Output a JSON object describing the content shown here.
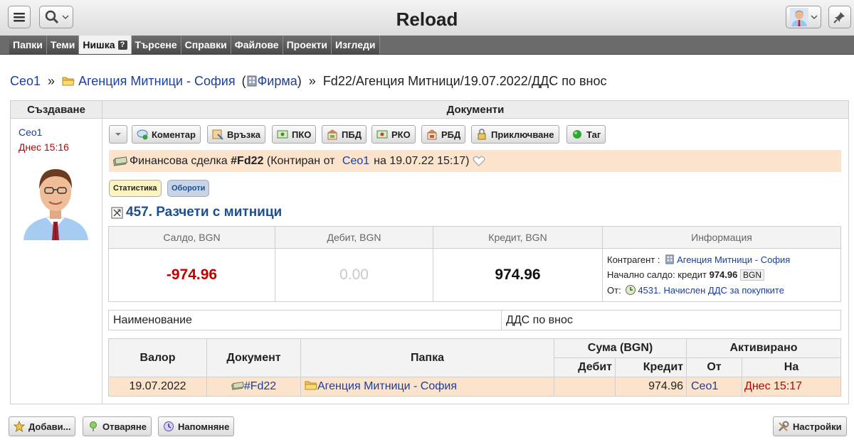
{
  "app": {
    "title": "Reload"
  },
  "nav": {
    "tabs": [
      "Папки",
      "Теми",
      "Нишка",
      "Търсене",
      "Справки",
      "Файлове",
      "Проекти",
      "Изгледи"
    ],
    "help_glyph": "?"
  },
  "breadcrumb": {
    "user": "Ceo1",
    "separator": "»",
    "folder": "Агенция Митници - София",
    "firm_open": "(",
    "firm": "Фирма",
    "firm_close": ")",
    "path": "Fd22/Агенция Митници/19.07.2022/ДДС по внос"
  },
  "left": {
    "header": "Създаване",
    "user": "Ceo1",
    "time": "Днес 15:16"
  },
  "right": {
    "header": "Документи"
  },
  "actions": [
    "Коментар",
    "Връзка",
    "ПКО",
    "ПБД",
    "РКО",
    "РБД",
    "Приключване",
    "Таг"
  ],
  "notice": {
    "prefix": "Финансова сделка",
    "id": "#Fd22",
    "posted": "(Контиран от",
    "user": "Ceo1",
    "on": "на 19.07.22 15:17)"
  },
  "pills": {
    "stats": "Статистика",
    "turnover": "Обороти"
  },
  "account": {
    "title": "457. Разчети с митници"
  },
  "summary": {
    "headers": [
      "Салдо, BGN",
      "Дебит, BGN",
      "Кредит, BGN",
      "Информация"
    ],
    "balance": "-974.96",
    "debit": "0.00",
    "credit": "974.96",
    "info": {
      "counterparty_label": "Контрагент :",
      "counterparty": "Агенция Митници - София",
      "opening_label": "Начално салдо: кредит",
      "opening_value": "974.96",
      "currency": "BGN",
      "from_label": "От:",
      "from_value": "4531. Начислен ДДС за покупките"
    }
  },
  "name_row": {
    "label": "Наименование",
    "value": "ДДС по внос"
  },
  "docs": {
    "headers": {
      "valor": "Валор",
      "document": "Документ",
      "folder": "Папка",
      "amount": "Сума (BGN)",
      "debit": "Дебит",
      "credit": "Кредит",
      "activated": "Активирано",
      "from": "От",
      "on": "На"
    },
    "rows": [
      {
        "valor": "19.07.2022",
        "document": "#Fd22",
        "folder": "Агенция Митници - София",
        "debit": "",
        "credit": "974.96",
        "from": "Ceo1",
        "on": "Днес 15:17"
      }
    ]
  },
  "bottom": {
    "add": "Добави...",
    "open": "Отваряне",
    "remind": "Напомняне",
    "settings": "Настройки"
  },
  "colors": {
    "link": "#1a3f9c",
    "negative": "#c00000",
    "highlight_row": "#fbe3cc",
    "nav_bg": "#6b6b6b"
  }
}
